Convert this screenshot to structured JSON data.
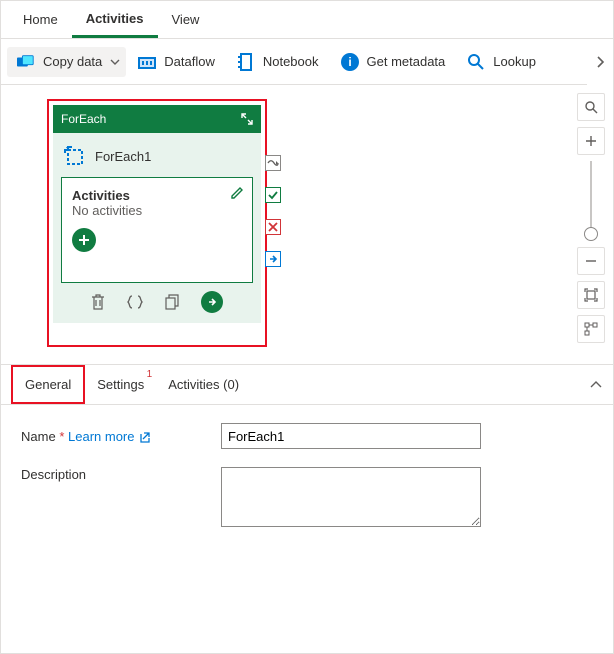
{
  "topTabs": {
    "home": "Home",
    "activities": "Activities",
    "view": "View"
  },
  "toolbar": {
    "copyData": "Copy data",
    "dataflow": "Dataflow",
    "notebook": "Notebook",
    "getMetadata": "Get metadata",
    "lookup": "Lookup"
  },
  "node": {
    "title": "ForEach",
    "name": "ForEach1",
    "activitiesLabel": "Activities",
    "noActivities": "No activities"
  },
  "propsTabs": {
    "general": "General",
    "settings": "Settings",
    "activities": "Activities (0)"
  },
  "props": {
    "nameLabel": "Name",
    "nameValue": "ForEach1",
    "learnMore": "Learn more",
    "descLabel": "Description",
    "descValue": ""
  }
}
